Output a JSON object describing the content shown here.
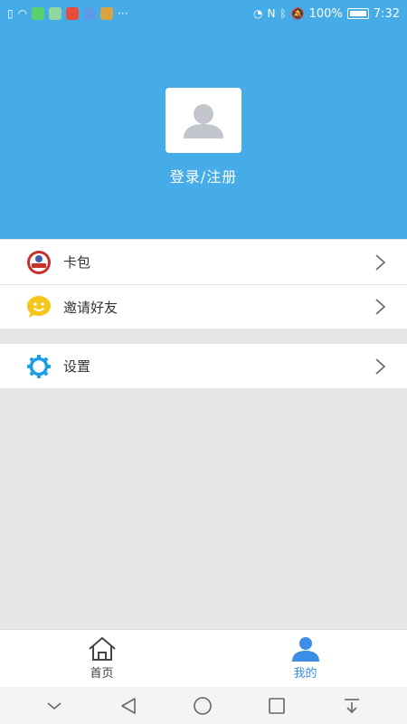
{
  "status_bar": {
    "battery": "100%",
    "time": "7:32"
  },
  "profile": {
    "login_label": "登录/注册"
  },
  "menu": {
    "items": [
      {
        "label": "卡包"
      },
      {
        "label": "邀请好友"
      },
      {
        "label": "设置"
      }
    ]
  },
  "bottom_nav": {
    "tabs": [
      {
        "label": "首页"
      },
      {
        "label": "我的"
      }
    ]
  },
  "colors": {
    "header_blue": "#45ace8",
    "active_tab": "#3b8ee6",
    "inactive_tab": "#444444",
    "settings_icon": "#1aa0e8",
    "invite_icon": "#f5c518",
    "card_icon": "#c8302a"
  }
}
